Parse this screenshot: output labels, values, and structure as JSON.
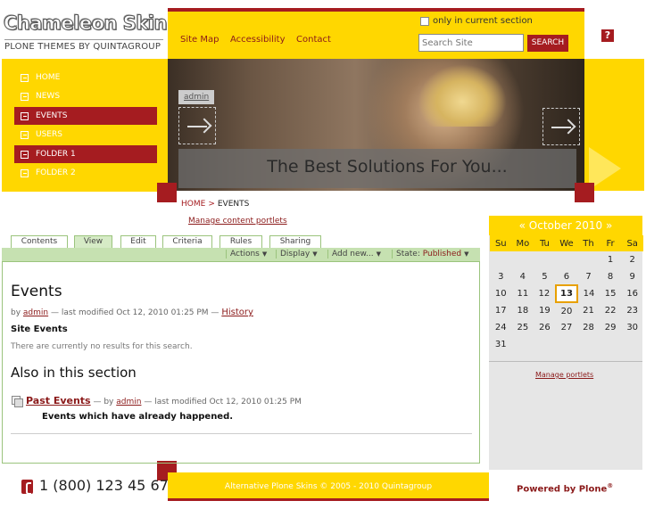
{
  "logo": {
    "title": "Chameleon Skin",
    "subtitle": "PLONE THEMES BY QUINTAGROUP"
  },
  "header": {
    "only_in_section": "only in current section",
    "search_placeholder": "Search Site",
    "search_button": "SEARCH",
    "help_icon": "?",
    "links": [
      "Site Map",
      "Accessibility",
      "Contact"
    ]
  },
  "nav": {
    "items": [
      {
        "label": "HOME",
        "active": false
      },
      {
        "label": "NEWS",
        "active": false
      },
      {
        "label": "EVENTS",
        "active": true
      },
      {
        "label": "USERS",
        "active": false
      },
      {
        "label": "FOLDER 1",
        "active": true
      },
      {
        "label": "FOLDER 2",
        "active": false
      }
    ]
  },
  "banner": {
    "admin_tag": "admin",
    "slogan": "The Best Solutions For You..."
  },
  "breadcrumb": {
    "home": "HOME",
    "separator": ">",
    "current": "EVENTS"
  },
  "manage_portlets": "Manage content portlets",
  "tabs": [
    "Contents",
    "View",
    "Edit",
    "Criteria",
    "Rules",
    "Sharing"
  ],
  "actions": {
    "actions": "Actions",
    "display": "Display",
    "add_new": "Add new...",
    "state_label": "State:",
    "state_value": "Published"
  },
  "content": {
    "heading": "Events",
    "by": "by",
    "author": "admin",
    "modified": "— last modified Oct 12, 2010 01:25 PM —",
    "history": "History",
    "description": "Site Events",
    "no_results": "There are currently no results for this search.",
    "also_heading": "Also in this section",
    "item_title": "Past Events",
    "item_by": "— by",
    "item_author": "admin",
    "item_modified": "— last modified Oct 12, 2010 01:25 PM",
    "item_description": "Events which have already happened."
  },
  "calendar": {
    "prev": "«",
    "month": "October 2010",
    "next": "»",
    "days": [
      "Su",
      "Mo",
      "Tu",
      "We",
      "Th",
      "Fr",
      "Sa"
    ],
    "weeks": [
      [
        "",
        "",
        "",
        "",
        "",
        "1",
        "2"
      ],
      [
        "3",
        "4",
        "5",
        "6",
        "7",
        "8",
        "9"
      ],
      [
        "10",
        "11",
        "12",
        "13",
        "14",
        "15",
        "16"
      ],
      [
        "17",
        "18",
        "19",
        "20",
        "21",
        "22",
        "23"
      ],
      [
        "24",
        "25",
        "26",
        "27",
        "28",
        "29",
        "30"
      ],
      [
        "31",
        "",
        "",
        "",
        "",
        "",
        ""
      ]
    ],
    "today": "13",
    "manage": "Manage portlets"
  },
  "footer": {
    "copyright": "Alternative Plone Skins © 2005 - 2010 Quintagroup",
    "phone": "1 (800) 123 45 67",
    "powered": "Powered by Plone",
    "reg": "®"
  },
  "colors": {
    "accent": "#a51c20",
    "yellow": "#ffd700",
    "green": "#9bc47d"
  }
}
